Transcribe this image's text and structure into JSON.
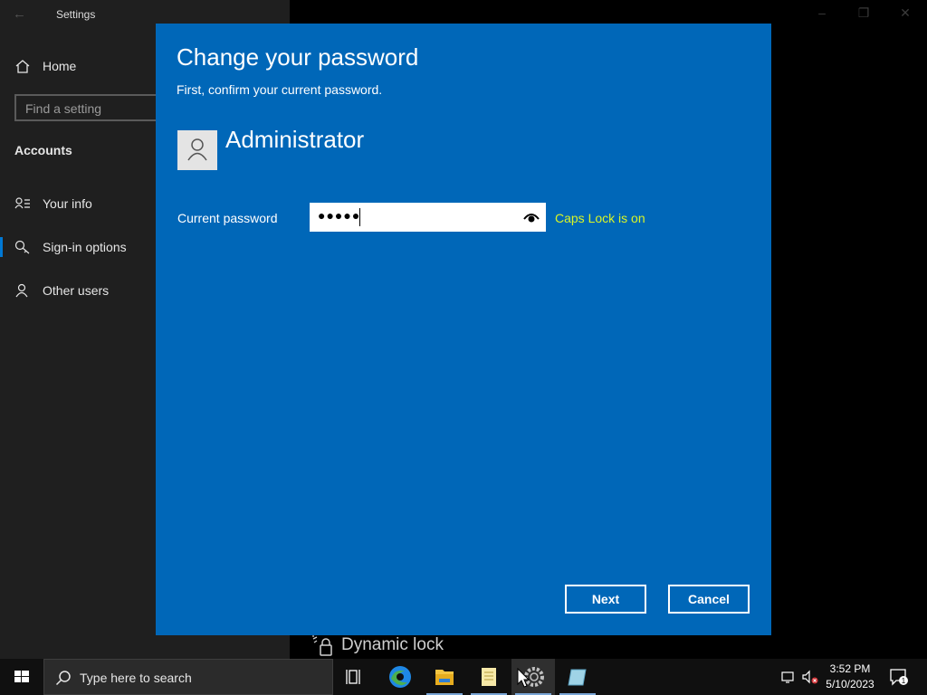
{
  "settings": {
    "app_title": "Settings",
    "nav": {
      "home_label": "Home",
      "search_placeholder": "Find a setting",
      "section_label": "Accounts",
      "items": [
        {
          "label": "Your info",
          "icon": "person-card-icon"
        },
        {
          "label": "Sign-in options",
          "icon": "key-icon"
        },
        {
          "label": "Other users",
          "icon": "person-icon"
        }
      ]
    },
    "background_item": {
      "label": "Dynamic lock",
      "icon": "dynamic-lock-icon"
    }
  },
  "dialog": {
    "title": "Change your password",
    "subtitle": "First, confirm your current password.",
    "user_name": "Administrator",
    "password_label": "Current password",
    "password_masked": "●●●●●",
    "caps_lock_warning": "Caps Lock is on",
    "next_label": "Next",
    "cancel_label": "Cancel",
    "background_color": "#0067b8",
    "warning_color": "#d9f526"
  },
  "taskbar": {
    "search_placeholder": "Type here to search",
    "time": "3:52 PM",
    "date": "5/10/2023",
    "notification_count": "1",
    "pinned": [
      "task-view-icon",
      "edge-icon",
      "file-explorer-icon",
      "notepad-icon",
      "settings-icon",
      "remote-app-icon"
    ]
  }
}
